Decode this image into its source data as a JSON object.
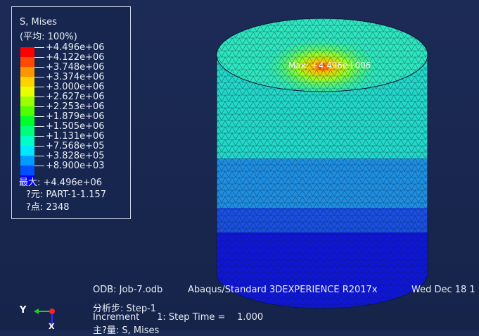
{
  "legend": {
    "title": "S, Mises",
    "subtitle": "(平均: 100%)",
    "colors": [
      "#ff0000",
      "#ff4a00",
      "#ff9600",
      "#ffd200",
      "#e8ff00",
      "#9cff00",
      "#50ff00",
      "#00ff2a",
      "#00ff78",
      "#00ffc6",
      "#00e8ff",
      "#009cff",
      "#0050ff",
      "#0000ff"
    ],
    "labels": [
      "+4.496e+06",
      "+4.122e+06",
      "+3.748e+06",
      "+3.374e+06",
      "+3.000e+06",
      "+2.627e+06",
      "+2.253e+06",
      "+1.879e+06",
      "+1.505e+06",
      "+1.131e+06",
      "+7.568e+05",
      "+3.828e+05",
      "+8.900e+03"
    ],
    "max": "最大: +4.496e+06",
    "element": "?元: PART-1-1.157",
    "node": "?点: 2348"
  },
  "model_label": "Max: +4.496e+006",
  "status": {
    "odb": "ODB: Job-7.odb",
    "solver": "Abaqus/Standard 3DEXPERIENCE R2017x",
    "date": "Wed Dec 18 1",
    "step": "分析步: Step-1",
    "increment": "Increment      1: Step Time =    1.000",
    "variable": "主?量: S, Mises"
  },
  "triad": {
    "y": "Y",
    "x": "X"
  }
}
